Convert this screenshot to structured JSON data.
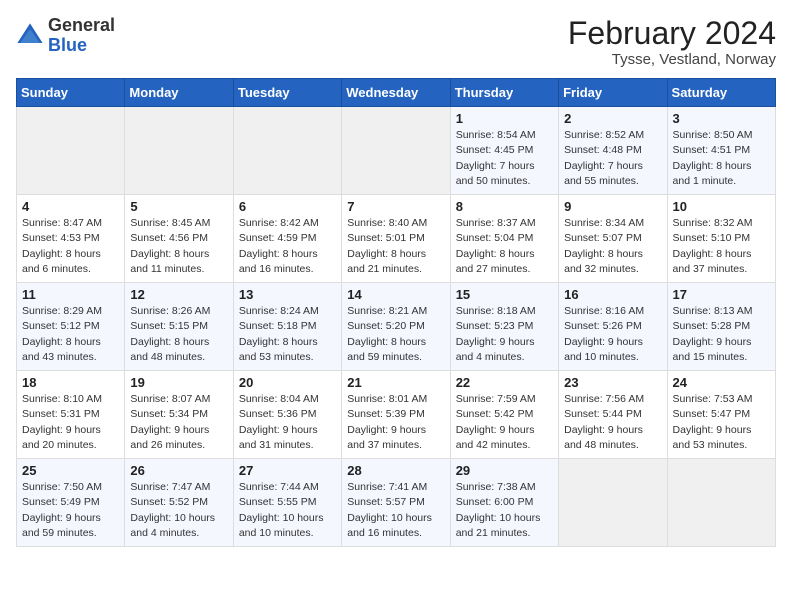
{
  "header": {
    "logo_line1": "General",
    "logo_line2": "Blue",
    "month_title": "February 2024",
    "location": "Tysse, Vestland, Norway"
  },
  "weekdays": [
    "Sunday",
    "Monday",
    "Tuesday",
    "Wednesday",
    "Thursday",
    "Friday",
    "Saturday"
  ],
  "weeks": [
    [
      {
        "day": "",
        "info": ""
      },
      {
        "day": "",
        "info": ""
      },
      {
        "day": "",
        "info": ""
      },
      {
        "day": "",
        "info": ""
      },
      {
        "day": "1",
        "info": "Sunrise: 8:54 AM\nSunset: 4:45 PM\nDaylight: 7 hours\nand 50 minutes."
      },
      {
        "day": "2",
        "info": "Sunrise: 8:52 AM\nSunset: 4:48 PM\nDaylight: 7 hours\nand 55 minutes."
      },
      {
        "day": "3",
        "info": "Sunrise: 8:50 AM\nSunset: 4:51 PM\nDaylight: 8 hours\nand 1 minute."
      }
    ],
    [
      {
        "day": "4",
        "info": "Sunrise: 8:47 AM\nSunset: 4:53 PM\nDaylight: 8 hours\nand 6 minutes."
      },
      {
        "day": "5",
        "info": "Sunrise: 8:45 AM\nSunset: 4:56 PM\nDaylight: 8 hours\nand 11 minutes."
      },
      {
        "day": "6",
        "info": "Sunrise: 8:42 AM\nSunset: 4:59 PM\nDaylight: 8 hours\nand 16 minutes."
      },
      {
        "day": "7",
        "info": "Sunrise: 8:40 AM\nSunset: 5:01 PM\nDaylight: 8 hours\nand 21 minutes."
      },
      {
        "day": "8",
        "info": "Sunrise: 8:37 AM\nSunset: 5:04 PM\nDaylight: 8 hours\nand 27 minutes."
      },
      {
        "day": "9",
        "info": "Sunrise: 8:34 AM\nSunset: 5:07 PM\nDaylight: 8 hours\nand 32 minutes."
      },
      {
        "day": "10",
        "info": "Sunrise: 8:32 AM\nSunset: 5:10 PM\nDaylight: 8 hours\nand 37 minutes."
      }
    ],
    [
      {
        "day": "11",
        "info": "Sunrise: 8:29 AM\nSunset: 5:12 PM\nDaylight: 8 hours\nand 43 minutes."
      },
      {
        "day": "12",
        "info": "Sunrise: 8:26 AM\nSunset: 5:15 PM\nDaylight: 8 hours\nand 48 minutes."
      },
      {
        "day": "13",
        "info": "Sunrise: 8:24 AM\nSunset: 5:18 PM\nDaylight: 8 hours\nand 53 minutes."
      },
      {
        "day": "14",
        "info": "Sunrise: 8:21 AM\nSunset: 5:20 PM\nDaylight: 8 hours\nand 59 minutes."
      },
      {
        "day": "15",
        "info": "Sunrise: 8:18 AM\nSunset: 5:23 PM\nDaylight: 9 hours\nand 4 minutes."
      },
      {
        "day": "16",
        "info": "Sunrise: 8:16 AM\nSunset: 5:26 PM\nDaylight: 9 hours\nand 10 minutes."
      },
      {
        "day": "17",
        "info": "Sunrise: 8:13 AM\nSunset: 5:28 PM\nDaylight: 9 hours\nand 15 minutes."
      }
    ],
    [
      {
        "day": "18",
        "info": "Sunrise: 8:10 AM\nSunset: 5:31 PM\nDaylight: 9 hours\nand 20 minutes."
      },
      {
        "day": "19",
        "info": "Sunrise: 8:07 AM\nSunset: 5:34 PM\nDaylight: 9 hours\nand 26 minutes."
      },
      {
        "day": "20",
        "info": "Sunrise: 8:04 AM\nSunset: 5:36 PM\nDaylight: 9 hours\nand 31 minutes."
      },
      {
        "day": "21",
        "info": "Sunrise: 8:01 AM\nSunset: 5:39 PM\nDaylight: 9 hours\nand 37 minutes."
      },
      {
        "day": "22",
        "info": "Sunrise: 7:59 AM\nSunset: 5:42 PM\nDaylight: 9 hours\nand 42 minutes."
      },
      {
        "day": "23",
        "info": "Sunrise: 7:56 AM\nSunset: 5:44 PM\nDaylight: 9 hours\nand 48 minutes."
      },
      {
        "day": "24",
        "info": "Sunrise: 7:53 AM\nSunset: 5:47 PM\nDaylight: 9 hours\nand 53 minutes."
      }
    ],
    [
      {
        "day": "25",
        "info": "Sunrise: 7:50 AM\nSunset: 5:49 PM\nDaylight: 9 hours\nand 59 minutes."
      },
      {
        "day": "26",
        "info": "Sunrise: 7:47 AM\nSunset: 5:52 PM\nDaylight: 10 hours\nand 4 minutes."
      },
      {
        "day": "27",
        "info": "Sunrise: 7:44 AM\nSunset: 5:55 PM\nDaylight: 10 hours\nand 10 minutes."
      },
      {
        "day": "28",
        "info": "Sunrise: 7:41 AM\nSunset: 5:57 PM\nDaylight: 10 hours\nand 16 minutes."
      },
      {
        "day": "29",
        "info": "Sunrise: 7:38 AM\nSunset: 6:00 PM\nDaylight: 10 hours\nand 21 minutes."
      },
      {
        "day": "",
        "info": ""
      },
      {
        "day": "",
        "info": ""
      }
    ]
  ]
}
